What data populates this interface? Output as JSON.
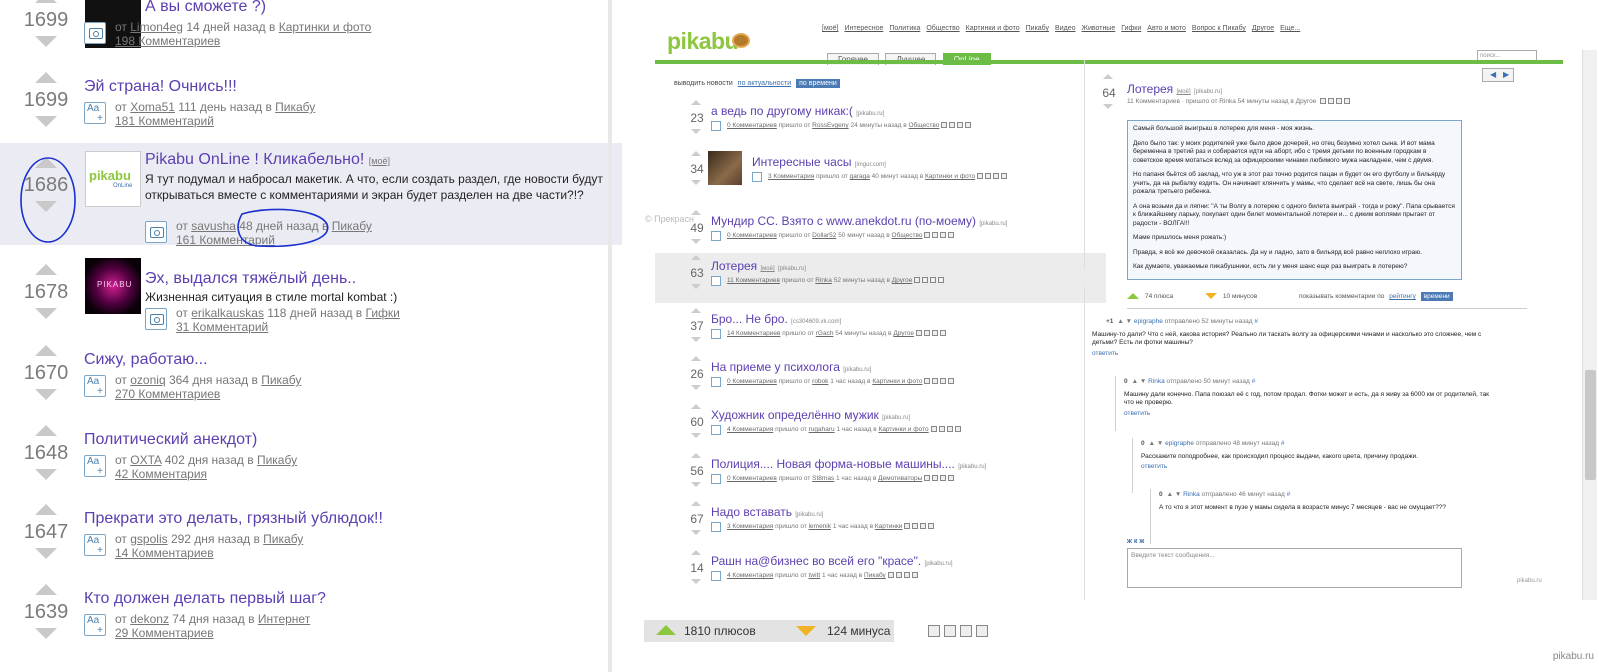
{
  "left": {
    "posts": [
      {
        "score": "1699",
        "title": "А вы сможете ?)",
        "by": "от",
        "author": "Limon4eg",
        "ago": "14 дней назад в",
        "category": "Картинки и фото",
        "comments": "198 Комментариев"
      },
      {
        "score": "1699",
        "title": "Эй страна! Очнись!!!",
        "by": "от",
        "author": "Xoma51",
        "ago": "111 день назад в",
        "category": "Пикабу",
        "comments": "181 Комментарий"
      },
      {
        "score": "1686",
        "title": "Pikabu OnLine ! Кликабельно!",
        "hashbadge": "[моё]",
        "desc": "Я тут подумал и набросал макетик. А что, если создать раздел, где новости будут открываться вместе с комментариями и экран будет разделен на две части?!?",
        "by": "от",
        "author": "savusha",
        "ago": "48 дней назад в",
        "category": "Пикабу",
        "comments": "161 Комментарий",
        "thumb_text": "pikabu",
        "thumb_sub": "OnLine"
      },
      {
        "score": "1678",
        "title": "Эх, выдался тяжёлый день..",
        "desc": "Жизненная ситуация в стиле mortal kombat :)",
        "by": "от",
        "author": "erikalkauskas",
        "ago": "118 дней назад в",
        "category": "Гифки",
        "comments": "31 Комментарий",
        "thumb_text": "PIKABU"
      },
      {
        "score": "1670",
        "title": "Сижу, работаю...",
        "by": "от",
        "author": "ozoniq",
        "ago": "364 дня назад в",
        "category": "Пикабу",
        "comments": "270 Комментариев"
      },
      {
        "score": "1648",
        "title": "Политический анекдот)",
        "by": "от",
        "author": "OXTA",
        "ago": "402 дня назад в",
        "category": "Пикабу",
        "comments": "42 Комментария"
      },
      {
        "score": "1647",
        "title": "Прекрати это делать, грязный ублюдок!!",
        "by": "от",
        "author": "gspolis",
        "ago": "292 дня назад в",
        "category": "Пикабу",
        "comments": "14 Комментариев"
      },
      {
        "score": "1639",
        "title": "Кто должен делать первый шаг?",
        "by": "от",
        "author": "dekonz",
        "ago": "74 дня назад в",
        "category": "Интернет",
        "comments": "29 Комментариев"
      }
    ]
  },
  "right": {
    "topnav": [
      "[моё]",
      "Интересное",
      "Политика",
      "Общество",
      "Картинки и фото",
      "Пикабу",
      "Видео",
      "Животные",
      "Гифки",
      "Авто и мото",
      "Вопрос к Пикабу",
      "Другое",
      "Еще..."
    ],
    "logo": "pikabu",
    "tabs": [
      "Горячее",
      "Лучшее",
      "OnLine"
    ],
    "search_placeholder": "поиск...",
    "sort_label": "выводить новости",
    "sort_opt1": "по актуальности",
    "sort_opt2": "по времени",
    "watermark": "© Прекрасн",
    "posts": [
      {
        "score": "23",
        "title": "а ведь по другому никак:(",
        "src": "[pikabu.ru]",
        "comments": "0 Комментариев",
        "author": "RossEvgeny",
        "ago": "24 минуты назад в",
        "category": "Общество"
      },
      {
        "score": "34",
        "title": "Интересные часы",
        "src": "[imgur.com]",
        "comments": "3 Комментария",
        "author": "garaga",
        "ago": "40 минут назад в",
        "category": "Картинки и фото"
      },
      {
        "score": "49",
        "title": "Мундир СС. Взято с www.anekdot.ru (по-моему)",
        "src": "[pikabu.ru]",
        "comments": "0 Комментариев",
        "author": "Dollar52",
        "ago": "50 минут назад в",
        "category": "Общество"
      },
      {
        "score": "63",
        "title": "Лотерея",
        "badge": "[моё]",
        "src": "[pikabu.ru]",
        "comments": "11 Комментариев",
        "author": "Rinka",
        "ago": "52 минуты назад в",
        "category": "Другое"
      },
      {
        "score": "37",
        "title": "Бро... Не бро.",
        "src": "[cs304609.vk.com]",
        "comments": "14 Комментариев",
        "author": "rGach",
        "ago": "54 минуты назад в",
        "category": "Другое"
      },
      {
        "score": "26",
        "title": "На приеме у психолога",
        "src": "[pikabu.ru]",
        "comments": "0 Комментариев",
        "author": "robok",
        "ago": "1 час назад в",
        "category": "Картинки и фото"
      },
      {
        "score": "60",
        "title": "Художник определённо мужик",
        "src": "[pikabu.ru]",
        "comments": "4 Комментария",
        "author": "rugaharu",
        "ago": "1 час назад в",
        "category": "Картинки и фото"
      },
      {
        "score": "56",
        "title": "Полиция.... Новая форма-новые машины....",
        "src": "[pikabu.ru]",
        "comments": "0 Комментариев",
        "author": "St8mas",
        "ago": "1 час назад в",
        "category": "Демотиваторы"
      },
      {
        "score": "67",
        "title": "Надо вставать",
        "src": "[pikabu.ru]",
        "comments": "3 Комментария",
        "author": "lemenik",
        "ago": "1 час назад в",
        "category": "Картинки"
      },
      {
        "score": "14",
        "title": "Рашн на@бизнес во всей его \"красе\".",
        "src": "[pikabu.ru]",
        "comments": "4 Комментария",
        "author": "twitt",
        "ago": "1 час назад в",
        "category": "Пикабу"
      }
    ],
    "meta_arrived": "пришло от",
    "detail": {
      "score": "64",
      "title": "Лотерея",
      "badge": "[моё]",
      "src": "[pikabu.ru]",
      "meta": "11 Комментариев · пришло от Rinka 54 минуты назад в Другое",
      "body": [
        "Самый большой выигрыш в лотерею для меня - моя жизнь.",
        "Дело было так: у моих родителей уже было двое дочерей, но отец безумно хотел сына. И вот мама беременна в третий раз и собирается идти на аборт, ибо с тремя детьми по военным городкам в советское время мотаться вслед за офицерскими чинами любимого мужа накладнее, чем с двумя.",
        "Но папаня бьётся об заклад, что уж в этот раз точно родится пацан и будет он его футболу и бильярду учить, да на рыбалку ездить. Он начинает клянчить у мамы, что сделает всё на свете, лишь бы она рожала третьего ребенка.",
        "А она возьми да и ляпни: \"А ты Волгу в лотерею с одного билета выиграй - тогда и рожу\". Папа срывается к ближайшему ларьку, покупает один билет моментальной лотереи и... с диким воплями прыгает от радости - ВОЛГА!!!",
        "Маме пришлось меня рожать:)",
        "Правда, я всё же девочкой оказалась. Да ну и ладно, зато в бильярд всё равно неплохо играю.",
        "Как думаете, уважаемые пикабушники, есть ли у меня шанс еще раз выиграть в лотерею?"
      ],
      "pluses": "74 плюса",
      "minuses": "10 минусов",
      "show_comments": "показывать комментарии по",
      "by_rating": "рейтингу",
      "by_time": "времени",
      "comments": [
        {
          "score": "+1",
          "author": "epigraphe",
          "time": "отправлено 52 минуты назад",
          "hash": "#",
          "text": "Машину-то дали? Что с ней, какова история? Реально ли таскать волгу за офицерскими чинами и насколько это сложнее, чем с детьми? Есть ли фотки машины?",
          "reply": "ответить"
        },
        {
          "score": "0",
          "author": "Rinka",
          "time": "отправлено 50 минут назад",
          "hash": "#",
          "text": "Машину дали конечно. Папа поюзал её с год, потом продал. Фотки может и есть, да я живу за 6000 км от родителей, так что не проверю.",
          "reply": "ответить"
        },
        {
          "score": "0",
          "author": "epigraphe",
          "time": "отправлено 48 минут назад",
          "hash": "#",
          "text": "Расскажите поподробнее, как происходил процесс выдачи, какого цвета, причину продажи.",
          "reply": "ответить"
        },
        {
          "score": "0",
          "author": "Rinka",
          "time": "отправлено 46 минут назад",
          "hash": "#",
          "text": "А то что я этот момент в пузе у мамы сидела в возрасте минус 7 месяцев - вас не смущает???",
          "reply": ""
        }
      ],
      "fmt": "ж  к  ж",
      "input_placeholder": "Введите текст сообщения...",
      "small_logo": "pikabu.ru"
    },
    "bottom_pluses": "1810 плюсов",
    "bottom_minuses": "124 минуса",
    "corner_watermark": "pikabu.ru"
  },
  "colors": {
    "title_purple": "#5c3fb0",
    "pikabu_green": "#8dc63f",
    "tab_green": "#6cbd45",
    "minus_orange": "#f0b323",
    "highlight_bg": "#ebecf3"
  }
}
